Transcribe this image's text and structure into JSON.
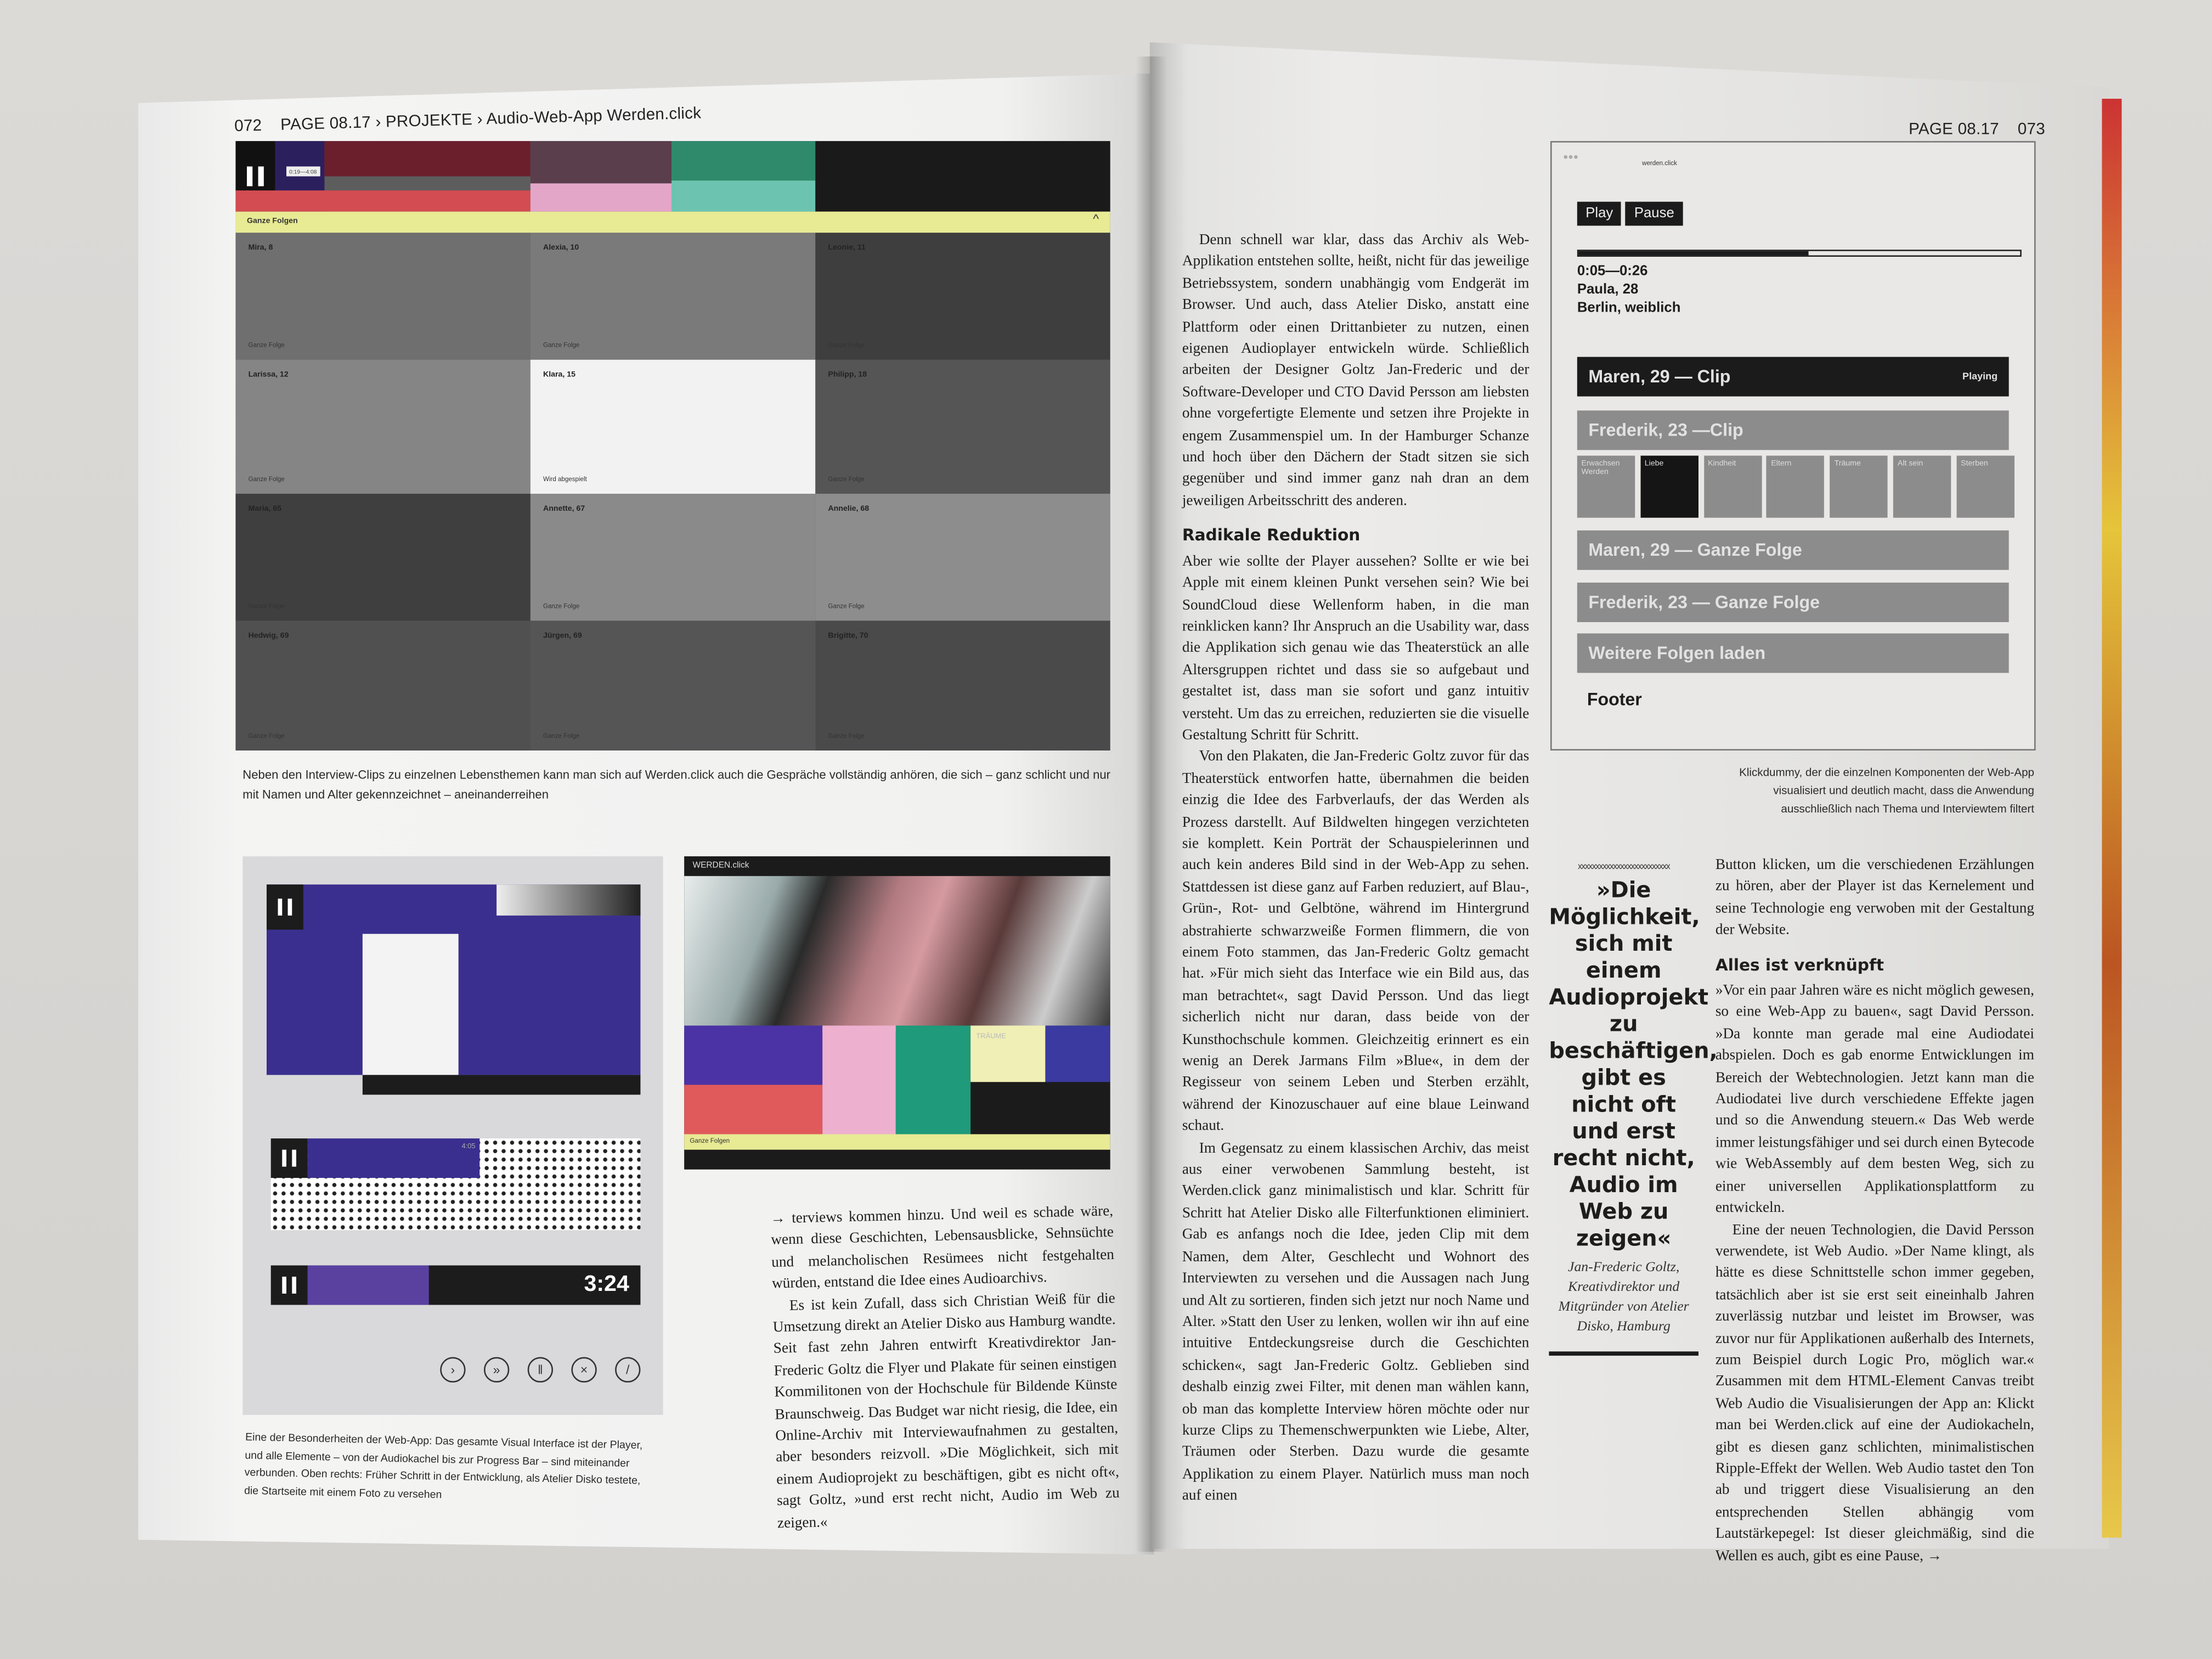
{
  "left_page": {
    "page_number": "072",
    "breadcrumb": "PAGE 08.17 › PROJEKTE › Audio-Web-App Werden.click",
    "top_screenshot": {
      "timecode": "0:19—4:08",
      "section_label": "Ganze Folgen",
      "strip_colors": [
        "#2c1f5e",
        "#6b1f2c",
        "#d24c52",
        "#5a3e4c",
        "#e3a6c8",
        "#2f8a6c",
        "#6cc4b0",
        "#1a1a1a",
        "#e8ea94"
      ],
      "cells": [
        {
          "name": "Mira, 8",
          "sub": "Ganze Folge"
        },
        {
          "name": "Alexia, 10",
          "sub": "Ganze Folge"
        },
        {
          "name": "Leonie, 11",
          "sub": "Ganze Folge"
        },
        {
          "name": "Larissa, 12",
          "sub": "Ganze Folge"
        },
        {
          "name": "Klara, 15",
          "sub": "Wird abgespielt"
        },
        {
          "name": "Philipp, 18",
          "sub": "Ganze Folge"
        },
        {
          "name": "Maria, 65",
          "sub": "Ganze Folge"
        },
        {
          "name": "Annette, 67",
          "sub": "Ganze Folge"
        },
        {
          "name": "Annelie, 68",
          "sub": "Ganze Folge"
        },
        {
          "name": "Hedwig, 69",
          "sub": "Ganze Folge"
        },
        {
          "name": "Jürgen, 69",
          "sub": "Ganze Folge"
        },
        {
          "name": "Brigitte, 70",
          "sub": "Ganze Folge"
        }
      ]
    },
    "caption_top": "Neben den Interview-Clips zu einzelnen Lebensthemen kann man sich auf Werden.click auch die Gespräche vollständig anhören, die sich – ganz schlicht und nur mit Namen und Alter gekennzeichnet – aneinanderreihen",
    "player_mockups": {
      "progress_time": "4:05",
      "duration": "3:24",
      "controls": [
        "play-icon",
        "fast-forward-icon",
        "pause-icon",
        "close-icon",
        "slash-icon"
      ]
    },
    "caption_bottom": "Eine der Besonderheiten der Web-App: Das gesamte Visual Interface ist der Player, und alle Elemente – von der Audiokachel bis zur Progress Bar – sind miteinander verbunden. Oben rechts: Früher Schritt in der Entwicklung, als Atelier Disko testete, die Startseite mit einem Foto zu versehen",
    "photo_mockup": {
      "logo": "WERDEN.click",
      "tile_label": "TRÄUME",
      "bar_label": "Ganze Folgen"
    },
    "body": [
      "→ terviews kommen hinzu. Und weil es schade wäre, wenn diese Geschichten, Lebensausblicke, Sehnsüchte und melancholischen Resümees nicht festgehalten würden, entstand die Idee eines Audioarchivs.",
      "Es ist kein Zufall, dass sich Christian Weiß für die Umsetzung direkt an Atelier Disko aus Hamburg wandte. Seit fast zehn Jahren entwirft Kreativdirektor Jan-Frederic Goltz die Flyer und Plakate für seinen einstigen Kommilitonen von der Hochschule für Bildende Künste Braunschweig. Das Budget war nicht riesig, die Idee, ein Online-Archiv mit Interviewaufnahmen zu gestalten, aber besonders reizvoll. »Die Möglichkeit, sich mit einem Audioprojekt zu beschäftigen, gibt es nicht oft«, sagt Goltz, »und erst recht nicht, Audio im Web zu zeigen.«"
    ]
  },
  "right_page": {
    "running_head": "PAGE 08.17",
    "page_number": "073",
    "column1": [
      "Denn schnell war klar, dass das Archiv als Web-Applikation entstehen sollte, heißt, nicht für das jeweilige Betriebssystem, sondern unabhängig vom Endgerät im Browser. Und auch, dass Atelier Disko, anstatt eine Plattform oder einen Drittanbieter zu nutzen, einen eigenen Audioplayer entwickeln würde. Schließlich arbeiten der Designer Goltz Jan-Frederic und der Software-Developer und CTO David Persson am liebsten ohne vorgefertigte Elemente und setzen ihre Projekte in engem Zusammenspiel um. In der Hamburger Schanze und hoch über den Dächern der Stadt sitzen sie sich gegenüber und sind immer ganz nah dran an dem jeweiligen Arbeitsschritt des anderen."
    ],
    "heading1": "Radikale Reduktion",
    "column1b": [
      "Aber wie sollte der Player aussehen? Sollte er wie bei Apple mit einem kleinen Punkt versehen sein? Wie bei SoundCloud diese Wellenform haben, in die man reinklicken kann? Ihr Anspruch an die Usability war, dass die Applikation sich genau wie das Theaterstück an alle Altersgruppen richtet und dass sie so aufgebaut und gestaltet ist, dass man sie sofort und ganz intuitiv versteht. Um das zu erreichen, reduzierten sie die visuelle Gestaltung Schritt für Schritt.",
      "Von den Plakaten, die Jan-Frederic Goltz zuvor für das Theaterstück entworfen hatte, übernahmen die beiden einzig die Idee des Farbverlaufs, der das Werden als Prozess darstellt. Auf Bildwelten hingegen verzichteten sie komplett. Kein Porträt der Schauspielerinnen und auch kein anderes Bild sind in der Web-App zu sehen. Stattdessen ist diese ganz auf Farben reduziert, auf Blau-, Grün-, Rot- und Gelbtöne, während im Hintergrund abstrahierte schwarzweiße Formen flimmern, die von einem Foto stammen, das Jan-Frederic Goltz gemacht hat. »Für mich sieht das Interface wie ein Bild aus, das man betrachtet«, sagt David Persson. Und das liegt sicherlich nicht nur daran, dass beide von der Kunsthochschule kommen. Gleichzeitig erinnert es ein wenig an Derek Jarmans Film »Blue«, in dem der Regisseur von seinem Leben und Sterben erzählt, während der Kinozuschauer auf eine blaue Leinwand schaut.",
      "Im Gegensatz zu einem klassischen Archiv, das meist aus einer verwobenen Sammlung besteht, ist Werden.click ganz minimalistisch und klar. Schritt für Schritt hat Atelier Disko alle Filterfunktionen eliminiert. Gab es anfangs noch die Idee, jeden Clip mit dem Namen, dem Alter, Geschlecht und Wohnort des Interviewten zu versehen und die Aussagen nach Jung und Alt zu sortieren, finden sich jetzt nur noch Name und Alter. »Statt den User zu lenken, wollen wir ihn auf eine intuitive Entdeckungsreise durch die Geschichten schicken«, sagt Jan-Frederic Goltz. Geblieben sind deshalb einzig zwei Filter, mit denen man wählen kann, ob man das komplette Interview hören möchte oder nur kurze Clips zu Themenschwerpunkten wie Liebe, Alter, Träumen oder Sterben. Dazu wurde die gesamte Applikation zu einem Player. Natürlich muss man noch auf einen"
    ],
    "wireframe": {
      "url": "werden.click",
      "play_label": "Play",
      "pause_label": "Pause",
      "progress_percent": 52,
      "time": "0:05—0:26",
      "speaker": "Paula, 28",
      "meta": "Berlin, weiblich",
      "now_playing": {
        "title": "Maren, 29 — Clip",
        "status": "Playing"
      },
      "next_clip": "Frederik, 23 —Clip",
      "topics": [
        "Erwachsen Werden",
        "Liebe",
        "Kindheit",
        "Eltern",
        "Träume",
        "Alt sein",
        "Sterben"
      ],
      "active_topic_index": 1,
      "episodes": [
        "Maren, 29 — Ganze Folge",
        "Frederik, 23 — Ganze Folge"
      ],
      "load_more": "Weitere Folgen laden",
      "footer": "Footer"
    },
    "wireframe_caption": "Klickdummy, der die einzelnen Komponenten der Web-App visualisiert und deutlich macht, dass die Anwendung ausschließlich nach Thema und Interviewtem filtert",
    "pull_quote": {
      "quote": "»Die Möglichkeit, sich mit einem Audioprojekt zu beschäftigen, gibt es nicht oft und erst recht nicht, Audio im Web zu zeigen«",
      "attribution": "Jan-Frederic Goltz, Kreativdirektor und Mitgründer von Atelier Disko, Hamburg"
    },
    "column3a": [
      "Button klicken, um die verschiedenen Erzählungen zu hören, aber der Player ist das Kernelement und seine Technologie eng verwoben mit der Gestaltung der Website."
    ],
    "heading2": "Alles ist verknüpft",
    "column3b": [
      "»Vor ein paar Jahren wäre es nicht möglich gewesen, so eine Web-App zu bauen«, sagt David Persson. »Da konnte man gerade mal eine Audiodatei abspielen. Doch es gab enorme Entwicklungen im Bereich der Webtechnologien. Jetzt kann man die Audiodatei live durch verschiedene Effekte jagen und so die Anwendung steuern.« Das Web werde immer leistungsfähiger und sei durch einen Bytecode wie WebAssembly auf dem besten Weg, sich zu einer universellen Applikationsplattform zu entwickeln.",
      "Eine der neuen Technologien, die David Persson verwendete, ist Web Audio. »Der Name klingt, als hätte es diese Schnittstelle schon immer gegeben, tatsächlich aber ist sie erst seit eineinhalb Jahren zuverlässig nutzbar und leistet im Browser, was zuvor nur für Applikationen außerhalb des Internets, zum Beispiel durch Logic Pro, möglich war.« Zusammen mit dem HTML-Element Canvas treibt Web Audio die Visualisierungen der App an: Klickt man bei Werden.click auf eine der Audiokacheln, gibt es diesen ganz schlichten, minimalistischen Ripple-Effekt der Wellen. Web Audio tastet den Ton ab und triggert diese Visualisierung an den entsprechenden Stellen abhängig vom Lautstärkepegel: Ist dieser gleichmäßig, sind die Wellen es auch, gibt es eine Pause, →"
    ]
  }
}
